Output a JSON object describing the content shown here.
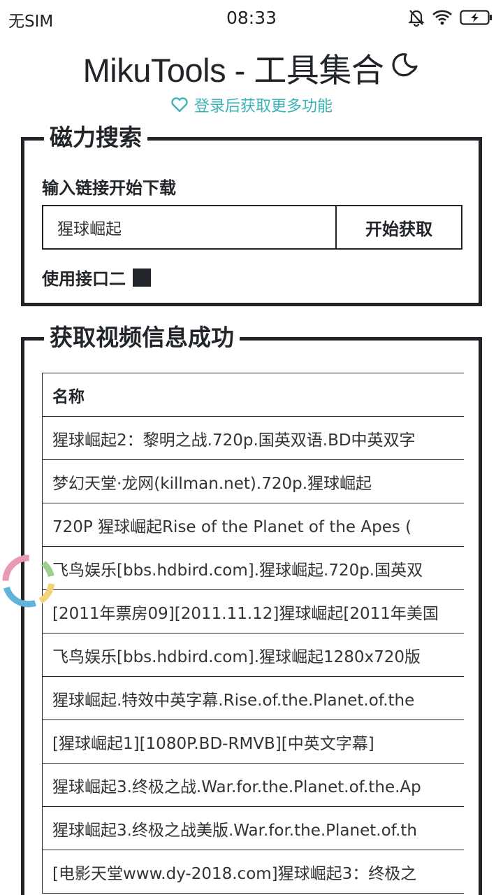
{
  "status_bar": {
    "carrier": "无SIM",
    "time": "08:33",
    "icons": [
      "mute-bell-icon",
      "wifi-icon",
      "battery-charging-icon"
    ]
  },
  "header": {
    "title": "MikuTools - 工具集合",
    "theme_icon": "moon-icon",
    "login_hint": "登录后获取更多功能",
    "login_icon": "heart-icon"
  },
  "magnet_search": {
    "legend": "磁力搜索",
    "input_label": "输入链接开始下载",
    "input_value": "猩球崛起",
    "fetch_button": "开始获取",
    "option_label": "使用接口二",
    "option_checked": true
  },
  "results": {
    "legend": "获取视频信息成功",
    "column_header": "名称",
    "rows": [
      "猩球崛起2：黎明之战.720p.国英双语.BD中英双字",
      "梦幻天堂·龙网(killman.net).720p.猩球崛起",
      "720P 猩球崛起Rise of the Planet of the Apes (",
      "飞鸟娱乐[bbs.hdbird.com].猩球崛起.720p.国英双",
      "[2011年票房09][2011.11.12]猩球崛起[2011年美国",
      "飞鸟娱乐[bbs.hdbird.com].猩球崛起1280x720版",
      "猩球崛起.特效中英字幕.Rise.of.the.Planet.of.the",
      "[猩球崛起1][1080P.BD-RMVB][中英文字幕]",
      "猩球崛起3.终极之战.War.for.the.Planet.of.the.Ap",
      "猩球崛起3.终极之战美版.War.for.the.Planet.of.th",
      "[电影天堂www.dy-2018.com]猩球崛起3：终极之"
    ]
  },
  "colors": {
    "text": "#212529",
    "accent": "#3db3b8",
    "border": "#212529"
  }
}
